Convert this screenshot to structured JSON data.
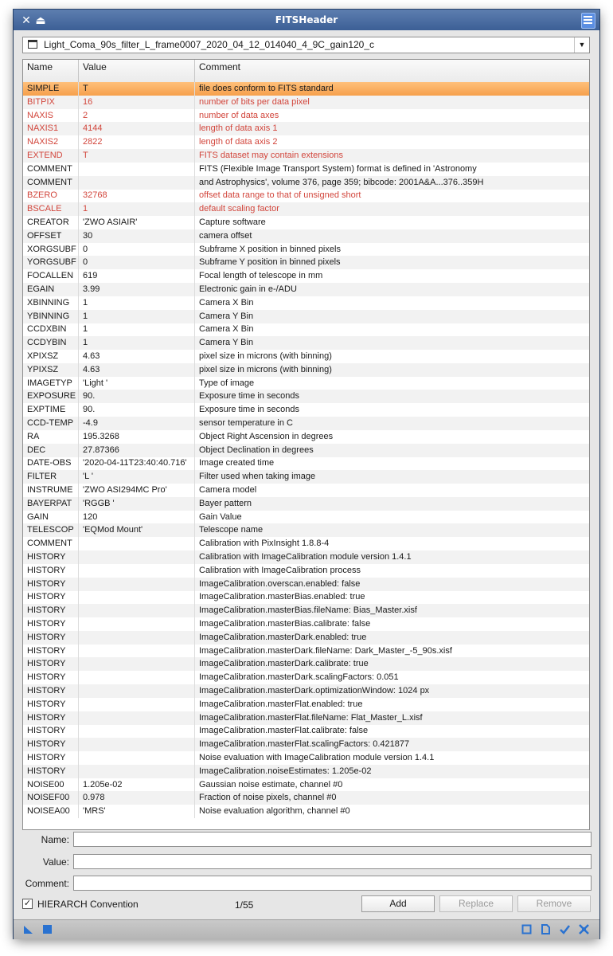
{
  "window": {
    "title": "FITSHeader",
    "close_glyph": "✕",
    "pin_glyph": "⏏"
  },
  "selector": {
    "value": "Light_Coma_90s_filter_L_frame0007_2020_04_12_014040_4_9C_gain120_c",
    "arrow_glyph": "▼"
  },
  "table": {
    "headers": {
      "name": "Name",
      "value": "Value",
      "comment": "Comment"
    },
    "selected_index": 0,
    "rows": [
      {
        "name": "SIMPLE",
        "value": "T",
        "comment": "file does conform to FITS standard",
        "reserved": true
      },
      {
        "name": "BITPIX",
        "value": "16",
        "comment": "number of bits per data pixel",
        "reserved": true
      },
      {
        "name": "NAXIS",
        "value": "2",
        "comment": "number of data axes",
        "reserved": true
      },
      {
        "name": "NAXIS1",
        "value": "4144",
        "comment": "length of data axis 1",
        "reserved": true
      },
      {
        "name": "NAXIS2",
        "value": "2822",
        "comment": "length of data axis 2",
        "reserved": true
      },
      {
        "name": "EXTEND",
        "value": "T",
        "comment": "FITS dataset may contain extensions",
        "reserved": true
      },
      {
        "name": "COMMENT",
        "value": "",
        "comment": "FITS (Flexible Image Transport System) format is defined in 'Astronomy",
        "reserved": false
      },
      {
        "name": "COMMENT",
        "value": "",
        "comment": "and Astrophysics', volume 376, page 359; bibcode: 2001A&A...376..359H",
        "reserved": false
      },
      {
        "name": "BZERO",
        "value": "32768",
        "comment": "offset data range to that of unsigned short",
        "reserved": true
      },
      {
        "name": "BSCALE",
        "value": "1",
        "comment": "default scaling factor",
        "reserved": true
      },
      {
        "name": "CREATOR",
        "value": "'ZWO ASIAIR'",
        "comment": "Capture software",
        "reserved": false
      },
      {
        "name": "OFFSET",
        "value": "30",
        "comment": "camera offset",
        "reserved": false
      },
      {
        "name": "XORGSUBF",
        "value": "0",
        "comment": "Subframe X position in binned pixels",
        "reserved": false
      },
      {
        "name": "YORGSUBF",
        "value": "0",
        "comment": "Subframe Y position in binned pixels",
        "reserved": false
      },
      {
        "name": "FOCALLEN",
        "value": "619",
        "comment": "Focal length of telescope in mm",
        "reserved": false
      },
      {
        "name": "EGAIN",
        "value": "3.99",
        "comment": "Electronic gain in e-/ADU",
        "reserved": false
      },
      {
        "name": "XBINNING",
        "value": "1",
        "comment": "Camera X Bin",
        "reserved": false
      },
      {
        "name": "YBINNING",
        "value": "1",
        "comment": "Camera Y Bin",
        "reserved": false
      },
      {
        "name": "CCDXBIN",
        "value": "1",
        "comment": "Camera X Bin",
        "reserved": false
      },
      {
        "name": "CCDYBIN",
        "value": "1",
        "comment": "Camera Y Bin",
        "reserved": false
      },
      {
        "name": "XPIXSZ",
        "value": "4.63",
        "comment": "pixel size in microns (with binning)",
        "reserved": false
      },
      {
        "name": "YPIXSZ",
        "value": "4.63",
        "comment": "pixel size in microns (with binning)",
        "reserved": false
      },
      {
        "name": "IMAGETYP",
        "value": "'Light '",
        "comment": "Type of image",
        "reserved": false
      },
      {
        "name": "EXPOSURE",
        "value": "90.",
        "comment": "Exposure time in seconds",
        "reserved": false
      },
      {
        "name": "EXPTIME",
        "value": "90.",
        "comment": "Exposure time in seconds",
        "reserved": false
      },
      {
        "name": "CCD-TEMP",
        "value": "-4.9",
        "comment": "sensor temperature in C",
        "reserved": false
      },
      {
        "name": "RA",
        "value": "195.3268",
        "comment": "Object Right Ascension in degrees",
        "reserved": false
      },
      {
        "name": "DEC",
        "value": "27.87366",
        "comment": "Object Declination in degrees",
        "reserved": false
      },
      {
        "name": "DATE-OBS",
        "value": "'2020-04-11T23:40:40.716'",
        "comment": "Image created time",
        "reserved": false
      },
      {
        "name": "FILTER",
        "value": "'L '",
        "comment": "Filter used when taking image",
        "reserved": false
      },
      {
        "name": "INSTRUME",
        "value": "'ZWO ASI294MC Pro'",
        "comment": "Camera model",
        "reserved": false
      },
      {
        "name": "BAYERPAT",
        "value": "'RGGB '",
        "comment": "Bayer pattern",
        "reserved": false
      },
      {
        "name": "GAIN",
        "value": "120",
        "comment": "Gain Value",
        "reserved": false
      },
      {
        "name": "TELESCOP",
        "value": "'EQMod Mount'",
        "comment": "Telescope name",
        "reserved": false
      },
      {
        "name": "COMMENT",
        "value": "",
        "comment": "Calibration with PixInsight 1.8.8-4",
        "reserved": false
      },
      {
        "name": "HISTORY",
        "value": "",
        "comment": "Calibration with ImageCalibration module version 1.4.1",
        "reserved": false
      },
      {
        "name": "HISTORY",
        "value": "",
        "comment": "Calibration with ImageCalibration process",
        "reserved": false
      },
      {
        "name": "HISTORY",
        "value": "",
        "comment": "ImageCalibration.overscan.enabled: false",
        "reserved": false
      },
      {
        "name": "HISTORY",
        "value": "",
        "comment": "ImageCalibration.masterBias.enabled: true",
        "reserved": false
      },
      {
        "name": "HISTORY",
        "value": "",
        "comment": "ImageCalibration.masterBias.fileName: Bias_Master.xisf",
        "reserved": false
      },
      {
        "name": "HISTORY",
        "value": "",
        "comment": "ImageCalibration.masterBias.calibrate: false",
        "reserved": false
      },
      {
        "name": "HISTORY",
        "value": "",
        "comment": "ImageCalibration.masterDark.enabled: true",
        "reserved": false
      },
      {
        "name": "HISTORY",
        "value": "",
        "comment": "ImageCalibration.masterDark.fileName: Dark_Master_-5_90s.xisf",
        "reserved": false
      },
      {
        "name": "HISTORY",
        "value": "",
        "comment": "ImageCalibration.masterDark.calibrate: true",
        "reserved": false
      },
      {
        "name": "HISTORY",
        "value": "",
        "comment": "ImageCalibration.masterDark.scalingFactors: 0.051",
        "reserved": false
      },
      {
        "name": "HISTORY",
        "value": "",
        "comment": "ImageCalibration.masterDark.optimizationWindow: 1024 px",
        "reserved": false
      },
      {
        "name": "HISTORY",
        "value": "",
        "comment": "ImageCalibration.masterFlat.enabled: true",
        "reserved": false
      },
      {
        "name": "HISTORY",
        "value": "",
        "comment": "ImageCalibration.masterFlat.fileName: Flat_Master_L.xisf",
        "reserved": false
      },
      {
        "name": "HISTORY",
        "value": "",
        "comment": "ImageCalibration.masterFlat.calibrate: false",
        "reserved": false
      },
      {
        "name": "HISTORY",
        "value": "",
        "comment": "ImageCalibration.masterFlat.scalingFactors: 0.421877",
        "reserved": false
      },
      {
        "name": "HISTORY",
        "value": "",
        "comment": "Noise evaluation with ImageCalibration module version 1.4.1",
        "reserved": false
      },
      {
        "name": "HISTORY",
        "value": "",
        "comment": "ImageCalibration.noiseEstimates: 1.205e-02",
        "reserved": false
      },
      {
        "name": "NOISE00",
        "value": "1.205e-02",
        "comment": "Gaussian noise estimate, channel #0",
        "reserved": false
      },
      {
        "name": "NOISEF00",
        "value": "0.978",
        "comment": "Fraction of noise pixels, channel #0",
        "reserved": false
      },
      {
        "name": "NOISEA00",
        "value": "'MRS'",
        "comment": "Noise evaluation algorithm, channel #0",
        "reserved": false
      }
    ]
  },
  "editor": {
    "name_label": "Name:",
    "value_label": "Value:",
    "comment_label": "Comment:",
    "name_value": "",
    "value_value": "",
    "comment_value": ""
  },
  "footer": {
    "hierarch_label": "HIERARCH Convention",
    "hierarch_checked": true,
    "check_glyph": "✓",
    "counter": "1/55",
    "add_label": "Add",
    "replace_label": "Replace",
    "remove_label": "Remove"
  },
  "statusbar": {
    "icons": [
      "new-instance-icon",
      "apply-global-icon",
      "preferences-icon",
      "documentation-icon",
      "apply-icon",
      "reset-icon"
    ]
  },
  "colors": {
    "title_bar": "#4a6ca3",
    "selected_row": "#f6a04c",
    "reserved_keyword": "#d2463c"
  }
}
